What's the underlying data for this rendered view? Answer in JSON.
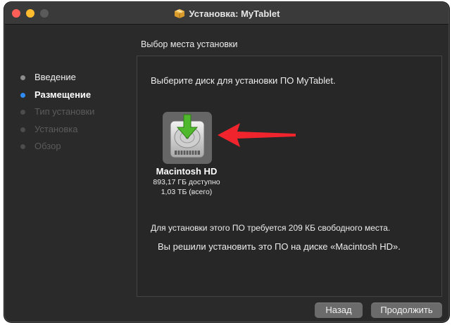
{
  "window": {
    "title": "Установка: MyTablet",
    "panel_title": "Выбор места установки"
  },
  "sidebar": {
    "steps": [
      {
        "label": "Введение",
        "state": "done"
      },
      {
        "label": "Размещение",
        "state": "active"
      },
      {
        "label": "Тип установки",
        "state": "future"
      },
      {
        "label": "Установка",
        "state": "future"
      },
      {
        "label": "Обзор",
        "state": "future"
      }
    ]
  },
  "content": {
    "prompt": "Выберите диск для установки ПО MyTablet.",
    "disk": {
      "name": "Macintosh HD",
      "free": "893,17 ГБ доступно",
      "total": "1,03 ТБ (всего)",
      "icon": "hard-drive-install-icon"
    },
    "requirement": "Для установки этого ПО требуется 209 КБ свободного места.",
    "choice": "Вы решили установить это ПО на диске «Macintosh HD»."
  },
  "buttons": {
    "back": "Назад",
    "continue": "Продолжить"
  },
  "colors": {
    "accent": "#2f8cf6",
    "annotation_arrow": "#f0242d",
    "install_arrow": "#4fb82c"
  }
}
